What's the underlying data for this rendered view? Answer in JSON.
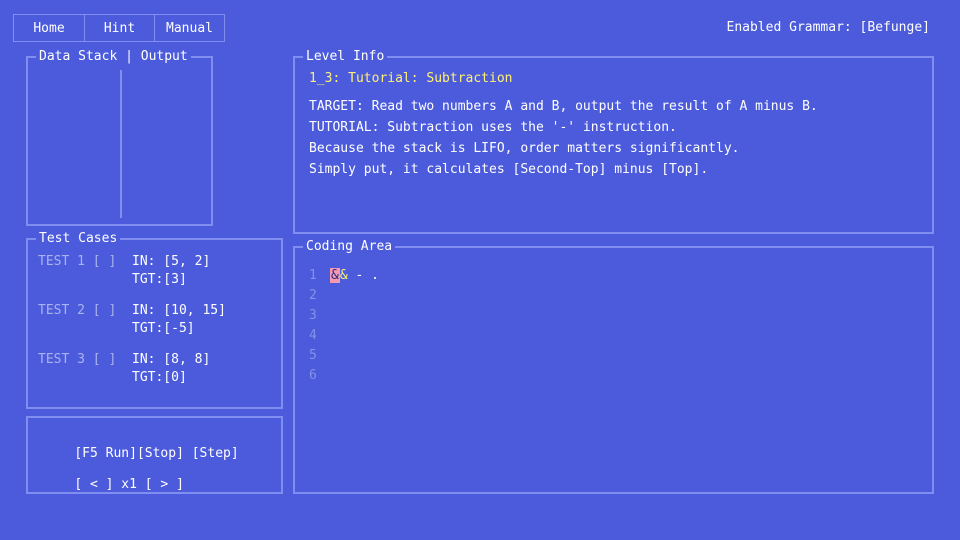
{
  "menu": {
    "home": "Home",
    "hint": "Hint",
    "manual": "Manual"
  },
  "grammar": "Enabled Grammar: [Befunge]",
  "data_stack": {
    "title": "Data Stack | Output"
  },
  "test_cases": {
    "title": "Test Cases",
    "items": [
      {
        "label": "TEST 1 [ ]",
        "in": "IN: [5, 2]",
        "tgt": "TGT:[3]"
      },
      {
        "label": "TEST 2 [ ]",
        "in": "IN: [10, 15]",
        "tgt": "TGT:[-5]"
      },
      {
        "label": "TEST 3 [ ]",
        "in": "IN: [8, 8]",
        "tgt": "TGT:[0]"
      }
    ]
  },
  "controls": {
    "run": "[F5 Run]",
    "stop": "[Stop]",
    "step": "[Step]",
    "prev": "[ < ]",
    "speed": "x1",
    "next": "[ > ]"
  },
  "level_info": {
    "title": "Level Info",
    "subtitle": "1_3: Tutorial: Subtraction",
    "lines": [
      "TARGET: Read two numbers A and B, output the result of A minus B.",
      "TUTORIAL: Subtraction uses the '-' instruction.",
      "Because the stack is LIFO, order matters significantly.",
      "Simply put, it calculates [Second-Top] minus [Top]."
    ]
  },
  "coding_area": {
    "title": "Coding Area",
    "line_numbers": [
      "1",
      "2",
      "3",
      "4",
      "5",
      "6"
    ],
    "code_line_1": {
      "cursor_char": "&",
      "rest_yellow": "&",
      "rest": " - ."
    }
  },
  "colors": {
    "background": "#4b5bdc",
    "border": "#7f8ef0",
    "highlight": "#fff176",
    "cursor": "#f49ab0"
  }
}
